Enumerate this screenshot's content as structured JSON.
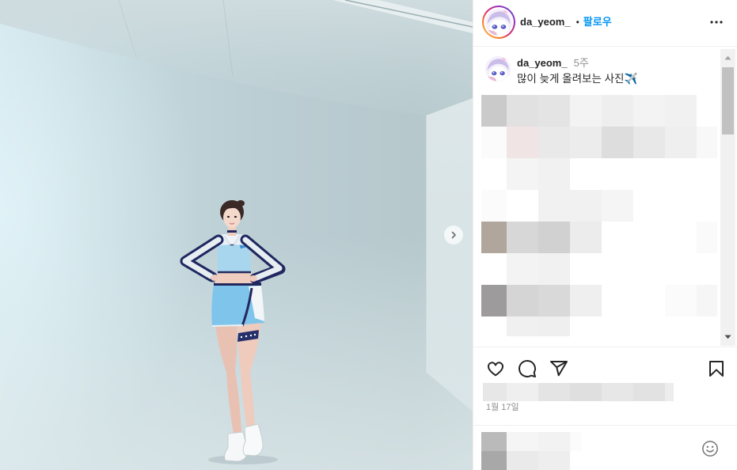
{
  "header": {
    "username": "da_yeom_",
    "separator": "•",
    "follow_label": "팔로우"
  },
  "caption": {
    "username": "da_yeom_",
    "time_ago": "5주",
    "text": "많이 늦게 올려보는 사진✈️"
  },
  "post_meta": {
    "date": "1월 17일"
  },
  "icons": {
    "next": "chevron-right-icon",
    "more": "more-horizontal-icon",
    "like": "heart-icon",
    "comment": "comment-icon",
    "share": "share-icon",
    "save": "bookmark-icon",
    "emoji": "emoji-icon",
    "scroll_up": "scroll-up-arrow-icon",
    "scroll_down": "scroll-down-arrow-icon"
  },
  "colors": {
    "accent": "#0095f6",
    "primary_text": "#262626",
    "secondary_text": "#8e8e8e",
    "divider": "#efefef",
    "story_ring": [
      "#feda75",
      "#fa7e1e",
      "#d62976",
      "#962fbf",
      "#4f5bd5"
    ]
  }
}
